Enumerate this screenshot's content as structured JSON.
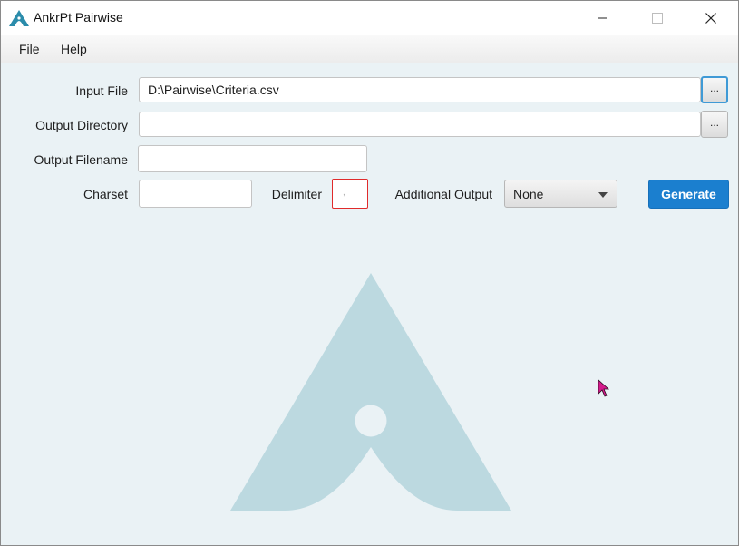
{
  "window": {
    "title": "AnkrPt Pairwise",
    "accent_color": "#1b7fcf",
    "background_color": "#eaf2f5",
    "icons": [
      "app-logo-icon",
      "minimize-icon",
      "maximize-icon",
      "close-icon"
    ]
  },
  "menu": {
    "file": "File",
    "help": "Help"
  },
  "form": {
    "input_file": {
      "label": "Input File",
      "value": "D:\\Pairwise\\Criteria.csv",
      "browse": "..."
    },
    "output_directory": {
      "label": "Output Directory",
      "value": "",
      "browse": "..."
    },
    "output_filename": {
      "label": "Output Filename",
      "value": ""
    },
    "charset": {
      "label": "Charset",
      "value": ""
    },
    "delimiter": {
      "label": "Delimiter",
      "value": ",",
      "border_color": "#e02b2b"
    },
    "additional_output": {
      "label": "Additional Output",
      "selected": "None"
    },
    "generate": "Generate"
  }
}
